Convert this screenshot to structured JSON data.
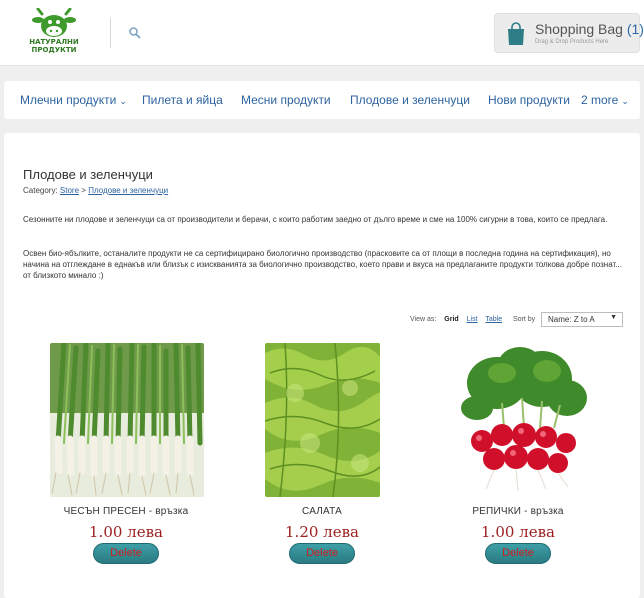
{
  "header": {
    "logo_text_line1": "НАТУРАЛНИ",
    "logo_text_line2": "ПРОДУКТИ",
    "search_icon": "search-icon",
    "bag": {
      "title": "Shopping Bag",
      "count": "(1)",
      "subtitle": "Drag & Drop Products Here",
      "icon": "shopping-bag-icon"
    }
  },
  "nav": {
    "items": [
      {
        "label": "Млечни продукти",
        "has_dropdown": true
      },
      {
        "label": "Пилета и яйца"
      },
      {
        "label": "Месни продукти"
      },
      {
        "label": "Плодове и зеленчуци"
      },
      {
        "label": "Нови продукти"
      },
      {
        "label": "2 more",
        "has_dropdown": true
      }
    ]
  },
  "page": {
    "title": "Плодове и зеленчуци",
    "category_label": "Category:",
    "breadcrumb": [
      "Store",
      "Плодове и зеленчуци"
    ],
    "breadcrumb_sep": ">",
    "description": [
      "Сезонните ни плодове и зеленчуци са от производители и берачи, с които работим заедно от дълго време и сме на 100% сигурни в това, които се предлага.",
      "Освен био-ябълките, останалите продукти не са сертифицирано биологично производство (прасковите са от площи в последна година на сертификация), но начина на отглеждане в еднакъв или близък с изискванията за биологично производство, което прави и вкуса на предлаганите продукти толкова добре познат... от близкото минало :)"
    ]
  },
  "toolbar": {
    "view_as_label": "View as:",
    "view_options": [
      "Grid",
      "List",
      "Table"
    ],
    "active_view": "Grid",
    "sort_by_label": "Sort by",
    "sort_value": "Name: Z to A"
  },
  "products": [
    {
      "name": "ЧЕСЪН ПРЕСЕН - връзка",
      "price": "1.00 лева",
      "button": "Delete"
    },
    {
      "name": "САЛАТА",
      "price": "1.20 лева",
      "button": "Delete"
    },
    {
      "name": "РЕПИЧКИ - връзка",
      "price": "1.00 лева",
      "button": "Delete"
    }
  ],
  "colors": {
    "link": "#2d63a0",
    "price": "#9c1f20",
    "delete_button_bg": "#2a7a82",
    "delete_text": "#cc1f1f",
    "brand_green": "#2f7a22"
  }
}
